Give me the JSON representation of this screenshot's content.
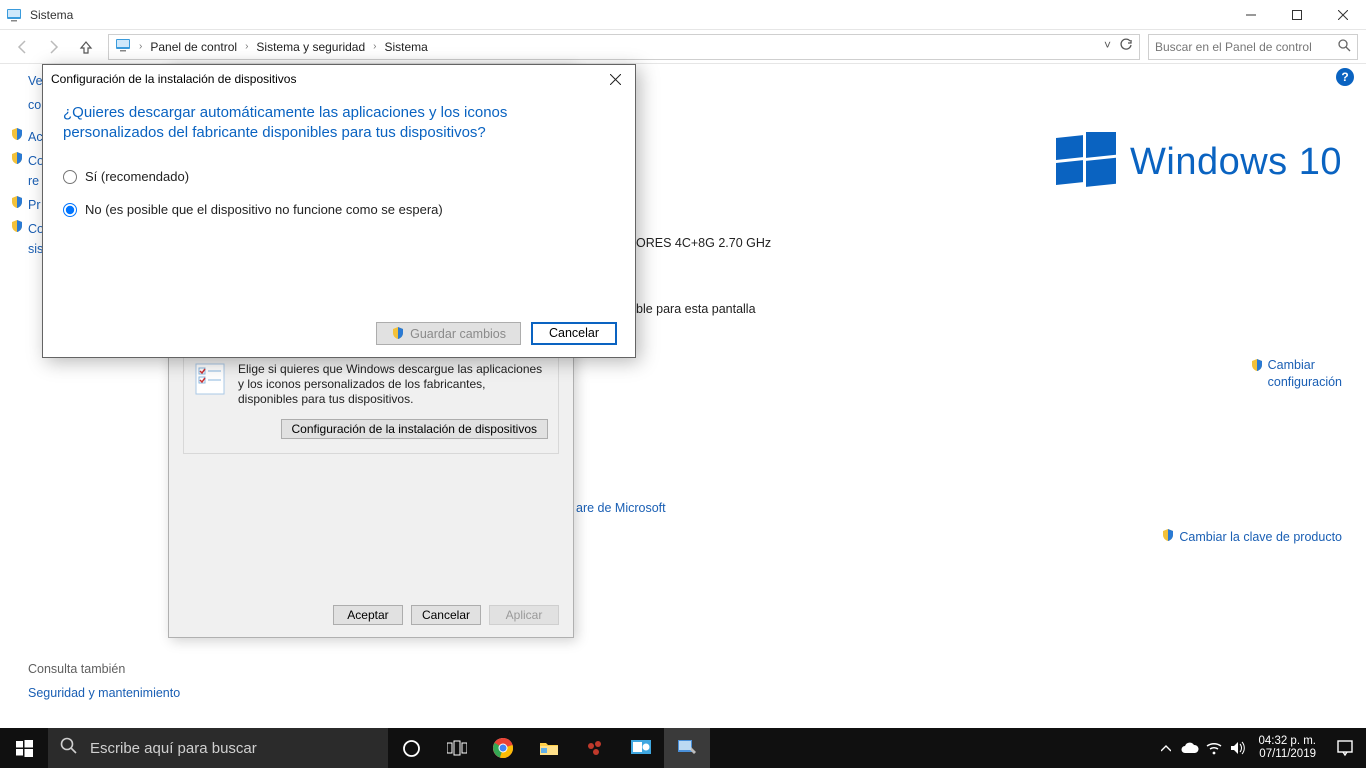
{
  "window": {
    "title": "Sistema"
  },
  "nav": {
    "breadcrumbs": [
      "Panel de control",
      "Sistema y seguridad",
      "Sistema"
    ],
    "search_placeholder": "Buscar en el Panel de control"
  },
  "sidebar": {
    "items": [
      {
        "label_fragment": "Ve"
      },
      {
        "label_fragment": "co"
      },
      {
        "label_fragment": "Ac"
      },
      {
        "label_fragment": "Co",
        "sub": "re"
      },
      {
        "label_fragment": "Pr"
      },
      {
        "label_fragment": "Co",
        "sub": "sis"
      }
    ]
  },
  "win10_brand": "Windows 10",
  "bg_info": {
    "processor_fragment": "ORES 4C+8G   2.70 GHz",
    "pen_fragment": "ble para esta pantalla",
    "ms_link_fragment": "are de Microsoft"
  },
  "right_links": {
    "change_config_l1": "Cambiar",
    "change_config_l2": "configuración",
    "change_key": "Cambiar la clave de producto"
  },
  "see_also": {
    "header": "Consulta también",
    "link": "Seguridad y mantenimiento"
  },
  "properties_window": {
    "group_legend": "Configuración de la instalación de dispositivos",
    "group_desc": "Elige si quieres que Windows descargue las aplicaciones y los iconos personalizados de los fabricantes, disponibles para tus dispositivos.",
    "group_button": "Configuración de la instalación de dispositivos",
    "footer": {
      "accept": "Aceptar",
      "cancel": "Cancelar",
      "apply": "Aplicar"
    }
  },
  "modal": {
    "title": "Configuración de la instalación de dispositivos",
    "question": "¿Quieres descargar automáticamente las aplicaciones y los iconos personalizados del fabricante disponibles para tus dispositivos?",
    "option_yes": "Sí (recomendado)",
    "option_no": "No (es posible que el dispositivo no funcione como se espera)",
    "save": "Guardar cambios",
    "cancel": "Cancelar"
  },
  "taskbar": {
    "search_placeholder": "Escribe aquí para buscar",
    "time": "04:32 p. m.",
    "date": "07/11/2019"
  }
}
